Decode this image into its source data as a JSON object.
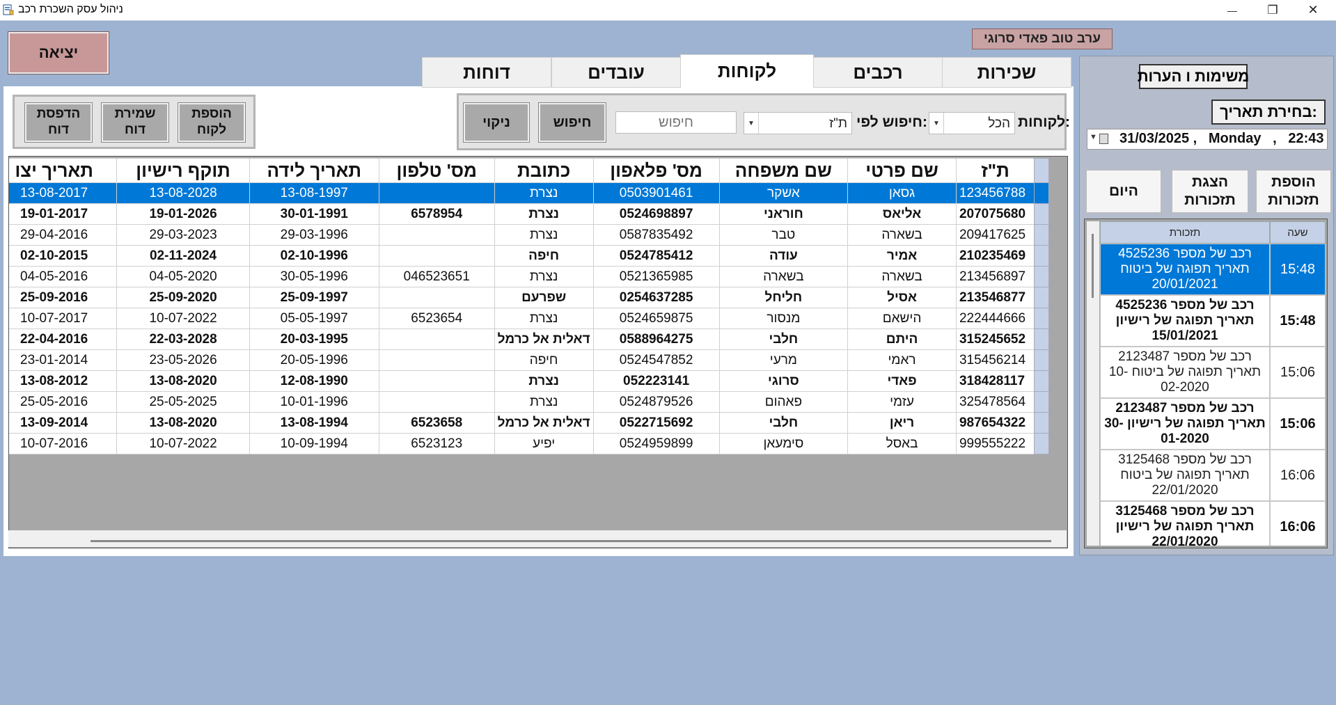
{
  "window": {
    "title": "ניהול עסק השכרת רכב",
    "minimize_glyph": "—",
    "maximize_glyph": "❐",
    "close_glyph": "✕"
  },
  "greeting": "ערב טוב פאדי סרוגי",
  "exit_label": "יציאה",
  "tabs": {
    "rentals": "שכירות",
    "vehicles": "רכבים",
    "customers": "לקוחות",
    "employees": "עובדים",
    "reports": "דוחות"
  },
  "active_tab": "customers",
  "search": {
    "customers_label": "לקוחות:",
    "customers_value": "הכל",
    "search_by_label": "חיפוש לפי:",
    "search_by_value": "ת\"ז",
    "placeholder": "חיפוש",
    "search_button": "חיפוש",
    "clear_button": "ניקוי"
  },
  "report_buttons": {
    "add_customer": "הוספת לקוח",
    "save_report": "שמירת דוח",
    "print_report": "הדפסת דוח"
  },
  "table": {
    "columns": [
      "ת\"ז",
      "שם פרטי",
      "שם משפחה",
      "מס' פלאפון",
      "כתובת",
      "מס' טלפון",
      "תאריך לידה",
      "תוקף רישיון",
      "תאריך יצו"
    ],
    "rows": [
      {
        "cells": [
          "123456788",
          "גסאן",
          "אשקר",
          "0503901461",
          "נצרת",
          "",
          "13-08-1997",
          "13-08-2028",
          "13-08-2017"
        ],
        "bold": false,
        "selected": true
      },
      {
        "cells": [
          "207075680",
          "אליאס",
          "חוראני",
          "0524698897",
          "נצרת",
          "6578954",
          "30-01-1991",
          "19-01-2026",
          "19-01-2017"
        ],
        "bold": true,
        "selected": false
      },
      {
        "cells": [
          "209417625",
          "בשארה",
          "טבר",
          "0587835492",
          "נצרת",
          "",
          "29-03-1996",
          "29-03-2023",
          "29-04-2016"
        ],
        "bold": false,
        "selected": false
      },
      {
        "cells": [
          "210235469",
          "אמיר",
          "עודה",
          "0524785412",
          "חיפה",
          "",
          "02-10-1996",
          "02-11-2024",
          "02-10-2015"
        ],
        "bold": true,
        "selected": false
      },
      {
        "cells": [
          "213456897",
          "בשארה",
          "בשארה",
          "0521365985",
          "נצרת",
          "046523651",
          "30-05-1996",
          "04-05-2020",
          "04-05-2016"
        ],
        "bold": false,
        "selected": false
      },
      {
        "cells": [
          "213546877",
          "אסיל",
          "חליחל",
          "0254637285",
          "שפרעם",
          "",
          "25-09-1997",
          "25-09-2020",
          "25-09-2016"
        ],
        "bold": true,
        "selected": false
      },
      {
        "cells": [
          "222444666",
          "הישאם",
          "מנסור",
          "0524659875",
          "נצרת",
          "6523654",
          "05-05-1997",
          "10-07-2022",
          "10-07-2017"
        ],
        "bold": false,
        "selected": false
      },
      {
        "cells": [
          "315245652",
          "היתם",
          "חלבי",
          "0588964275",
          "דאלית אל כרמל",
          "",
          "20-03-1995",
          "22-03-2028",
          "22-04-2016"
        ],
        "bold": true,
        "selected": false
      },
      {
        "cells": [
          "315456214",
          "ראמי",
          "מרעי",
          "0524547852",
          "חיפה",
          "",
          "20-05-1996",
          "23-05-2026",
          "23-01-2014"
        ],
        "bold": false,
        "selected": false
      },
      {
        "cells": [
          "318428117",
          "פאדי",
          "סרוגי",
          "052223141",
          "נצרת",
          "",
          "12-08-1990",
          "13-08-2020",
          "13-08-2012"
        ],
        "bold": true,
        "selected": false
      },
      {
        "cells": [
          "325478564",
          "עזמי",
          "פאהום",
          "0524879526",
          "נצרת",
          "",
          "10-01-1996",
          "25-05-2025",
          "25-05-2016"
        ],
        "bold": false,
        "selected": false
      },
      {
        "cells": [
          "987654322",
          "ריאן",
          "חלבי",
          "0522715692",
          "דאלית אל כרמל",
          "6523658",
          "13-08-1994",
          "13-08-2020",
          "13-09-2014"
        ],
        "bold": true,
        "selected": false
      },
      {
        "cells": [
          "999555222",
          "באסל",
          "סימעאן",
          "0524959899",
          "יפיע",
          "6523123",
          "10-09-1994",
          "10-07-2022",
          "10-07-2016"
        ],
        "bold": false,
        "selected": false
      }
    ]
  },
  "right_panel": {
    "notes_title": "משימות ו הערות",
    "date_label": "בחירת תאריך:",
    "date_value": "31/03/2025 ,   Monday   ,   22:43",
    "today_button": "היום",
    "show_reminders_button": "הצגת תזכורות",
    "add_reminder_button": "הוספת תזכורות",
    "reminders": {
      "header_reminder": "תזכורת",
      "header_time": "שעה",
      "rows": [
        {
          "text": "רכב של מספר 4525236 תאריך תפוגה של ביטוח 20/01/2021",
          "time": "15:48",
          "bold": false,
          "selected": true
        },
        {
          "text": "רכב של מספר 4525236 תאריך תפוגה של רישיון 15/01/2021",
          "time": "15:48",
          "bold": true,
          "selected": false
        },
        {
          "text": "רכב של מספר 2123487 תאריך תפוגה של ביטוח 10-02-2020",
          "time": "15:06",
          "bold": false,
          "selected": false
        },
        {
          "text": "רכב של מספר 2123487 תאריך תפוגה של רישיון 30-01-2020",
          "time": "15:06",
          "bold": true,
          "selected": false
        },
        {
          "text": "רכב של מספר 3125468 תאריך תפוגה של ביטוח 22/01/2020",
          "time": "16:06",
          "bold": false,
          "selected": false
        },
        {
          "text": "רכב של מספר 3125468 תאריך תפוגה של רישיון 22/01/2020",
          "time": "16:06",
          "bold": true,
          "selected": false
        }
      ]
    }
  }
}
